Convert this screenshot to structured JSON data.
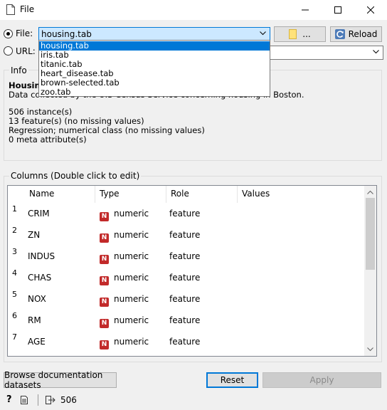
{
  "window": {
    "title": "File"
  },
  "source": {
    "file_label": "File:",
    "file_selected": "housing.tab",
    "browse_label": "...",
    "reload_label": "Reload",
    "url_label": "URL:",
    "url_value": ""
  },
  "dropdown": {
    "items": [
      "housing.tab",
      "iris.tab",
      "titanic.tab",
      "heart_disease.tab",
      "brown-selected.tab",
      "zoo.tab"
    ]
  },
  "info": {
    "title": "Info",
    "name": "Housing",
    "description": "Data collected by the U.S Census Service concerning housing in Boston.",
    "lines": [
      "506 instance(s)",
      "13 feature(s) (no missing values)",
      "Regression; numerical class (no missing values)",
      "0 meta attribute(s)"
    ]
  },
  "columns": {
    "title": "Columns (Double click to edit)",
    "headers": [
      "Name",
      "Type",
      "Role",
      "Values"
    ],
    "rows": [
      {
        "index": "1",
        "name": "CRIM",
        "type": "numeric",
        "role": "feature",
        "values": ""
      },
      {
        "index": "2",
        "name": "ZN",
        "type": "numeric",
        "role": "feature",
        "values": ""
      },
      {
        "index": "3",
        "name": "INDUS",
        "type": "numeric",
        "role": "feature",
        "values": ""
      },
      {
        "index": "4",
        "name": "CHAS",
        "type": "numeric",
        "role": "feature",
        "values": ""
      },
      {
        "index": "5",
        "name": "NOX",
        "type": "numeric",
        "role": "feature",
        "values": ""
      },
      {
        "index": "6",
        "name": "RM",
        "type": "numeric",
        "role": "feature",
        "values": ""
      },
      {
        "index": "7",
        "name": "AGE",
        "type": "numeric",
        "role": "feature",
        "values": ""
      }
    ],
    "type_badge": "N"
  },
  "buttons": {
    "browse_docs": "Browse documentation datasets",
    "reset": "Reset",
    "apply": "Apply"
  },
  "status": {
    "output_count": "506"
  },
  "colors": {
    "accent": "#0078d7",
    "numeric_badge": "#c22a2a",
    "highlight": "#cce8ff"
  }
}
